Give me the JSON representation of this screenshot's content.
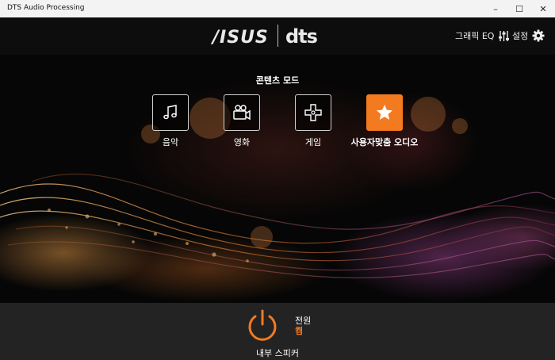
{
  "window": {
    "title": "DTS Audio Processing",
    "minimize": "–",
    "maximize": "☐",
    "close": "✕"
  },
  "header": {
    "asus_logo": "/ISUS",
    "dts_logo": "dts",
    "eq_label": "그래픽 EQ",
    "settings_label": "설정"
  },
  "content_mode": {
    "title": "콘텐츠 모드",
    "modes": [
      {
        "label": "음악",
        "icon": "music-note-icon",
        "active": false
      },
      {
        "label": "영화",
        "icon": "movie-camera-icon",
        "active": false
      },
      {
        "label": "게임",
        "icon": "gamepad-icon",
        "active": false
      },
      {
        "label": "사용자맞춤 오디오",
        "icon": "star-icon",
        "active": true
      }
    ]
  },
  "footer": {
    "power_label": "전원",
    "power_state": "켬",
    "device_name": "내부 스피커"
  },
  "colors": {
    "accent": "#f47a20",
    "header_bg": "#0d0d0d",
    "footer_bg": "#232323"
  }
}
